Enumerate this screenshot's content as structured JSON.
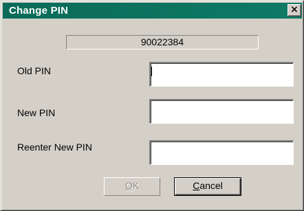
{
  "window": {
    "title": "Change PIN",
    "close_glyph": "×"
  },
  "serial": "90022384",
  "fields": [
    {
      "label": "Old PIN",
      "value": ""
    },
    {
      "label": "New PIN",
      "value": ""
    },
    {
      "label": "Reenter New PIN",
      "value": ""
    }
  ],
  "buttons": {
    "ok": {
      "mnemonic": "O",
      "rest": "K",
      "enabled": false
    },
    "cancel": {
      "mnemonic": "C",
      "rest": "ancel"
    }
  },
  "colors": {
    "titlebar": "#0a6b58",
    "face": "#d4d0c8"
  }
}
